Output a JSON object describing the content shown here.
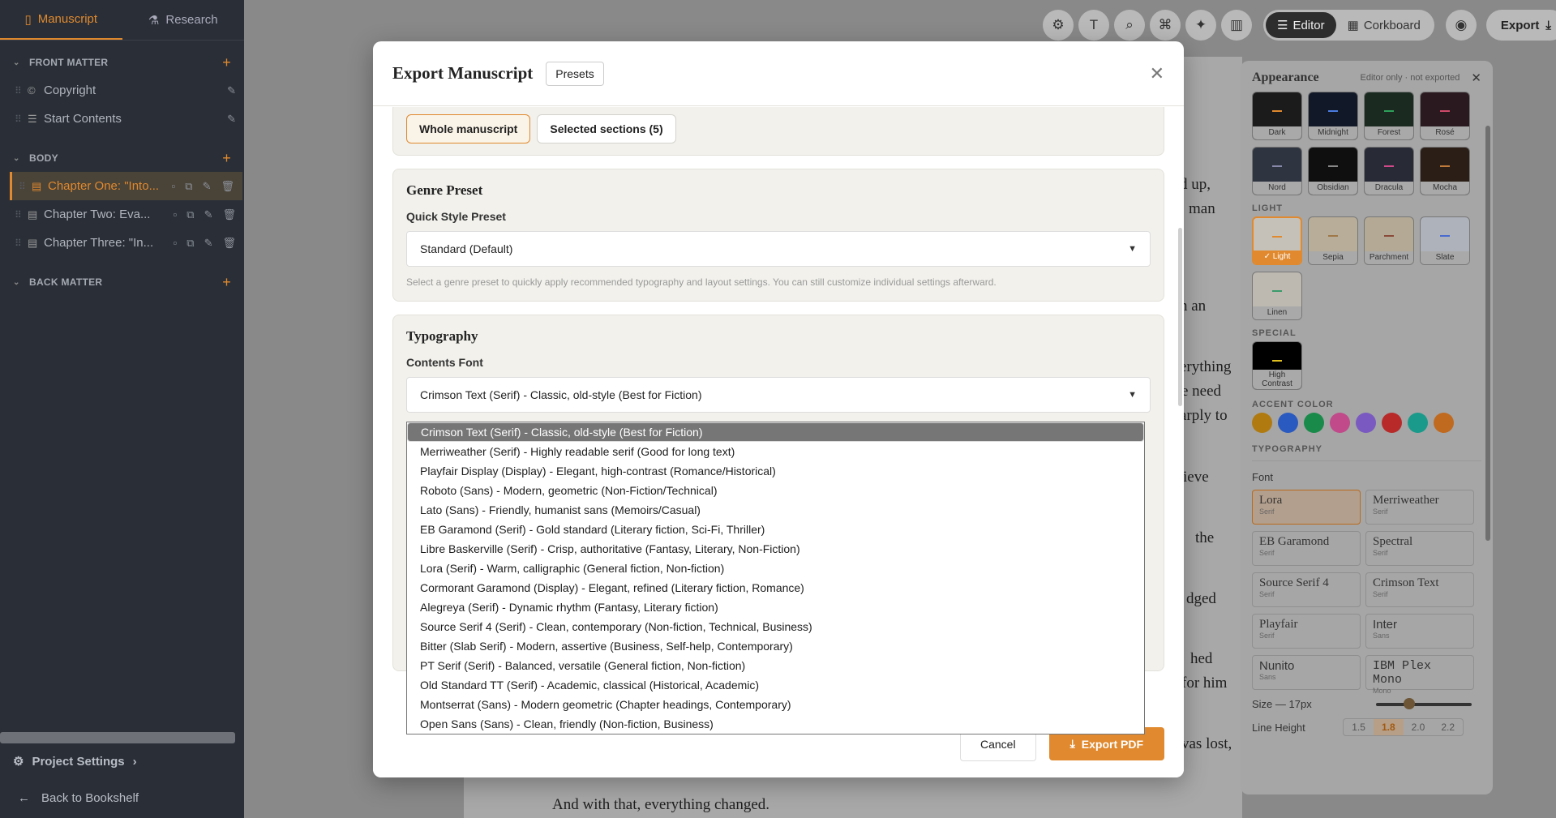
{
  "sidebar": {
    "tabs": [
      {
        "label": "Manuscript",
        "icon": "book-icon"
      },
      {
        "label": "Research",
        "icon": "flask-icon"
      }
    ],
    "sections": [
      {
        "label": "FRONT MATTER",
        "items": [
          {
            "label": "Copyright",
            "icon": "copyright-icon"
          },
          {
            "label": "Start Contents",
            "icon": "list-icon"
          }
        ]
      },
      {
        "label": "BODY",
        "items": [
          {
            "label": "Chapter One: \"Into...",
            "icon": "document-icon"
          },
          {
            "label": "Chapter Two: Eva...",
            "icon": "document-icon"
          },
          {
            "label": "Chapter Three: \"In...",
            "icon": "document-icon"
          }
        ]
      },
      {
        "label": "BACK MATTER",
        "items": []
      }
    ],
    "project_settings": "Project Settings",
    "back": "Back to Bookshelf"
  },
  "topbar": {
    "editor": "Editor",
    "corkboard": "Corkboard",
    "export": "Export"
  },
  "document": {
    "fragments": [
      "d up,",
      "man",
      "n an",
      "erything",
      "e need",
      "arply to",
      "ieve",
      "the",
      "dged",
      "hed",
      "for him",
      "vas lost,"
    ],
    "last_line": "And with that, everything changed."
  },
  "appearance": {
    "title": "Appearance",
    "subtitle": "Editor only · not exported",
    "dark_themes": [
      {
        "name": "Dark",
        "bg": "#1b1b1b",
        "accent": "#e0892e"
      },
      {
        "name": "Midnight",
        "bg": "#111827",
        "accent": "#4a7be0"
      },
      {
        "name": "Forest",
        "bg": "#1a2a20",
        "accent": "#2ea05a"
      },
      {
        "name": "Rosé",
        "bg": "#2a1a20",
        "accent": "#d04a6a"
      },
      {
        "name": "Nord",
        "bg": "#2e3440",
        "accent": "#88a"
      },
      {
        "name": "Obsidian",
        "bg": "#0f0f0f",
        "accent": "#888"
      },
      {
        "name": "Dracula",
        "bg": "#282a36",
        "accent": "#d04a8a"
      },
      {
        "name": "Mocha",
        "bg": "#2a1e17",
        "accent": "#c07a3a"
      }
    ],
    "light_label": "LIGHT",
    "light_themes": [
      {
        "name": "✓ Light",
        "bg": "#c6c1b8",
        "accent": "#e0892e"
      },
      {
        "name": "Sepia",
        "bg": "#b8ad98",
        "accent": "#a0784a"
      },
      {
        "name": "Parchment",
        "bg": "#b3a994",
        "accent": "#8a4a3a"
      },
      {
        "name": "Slate",
        "bg": "#aeb3bb",
        "accent": "#4a6ad0"
      },
      {
        "name": "Linen",
        "bg": "#bdb9b1",
        "accent": "#3a9a6a"
      }
    ],
    "special_label": "SPECIAL",
    "special_themes": [
      {
        "name": "High Contrast",
        "bg": "#000000",
        "accent": "#e0c020"
      }
    ],
    "accent_label": "ACCENT COLOR",
    "accent_colors": [
      "#b07a10",
      "#2a5ac0",
      "#1a8a4a",
      "#c04a8a",
      "#7a5ac0",
      "#b82a2a",
      "#1a9a8a",
      "#c06a20"
    ],
    "typography_label": "TYPOGRAPHY",
    "font_label": "Font",
    "fonts": [
      {
        "name": "Lora",
        "kind": "Serif"
      },
      {
        "name": "Merriweather",
        "kind": "Serif"
      },
      {
        "name": "EB Garamond",
        "kind": "Serif"
      },
      {
        "name": "Spectral",
        "kind": "Serif"
      },
      {
        "name": "Source Serif 4",
        "kind": "Serif"
      },
      {
        "name": "Crimson Text",
        "kind": "Serif"
      },
      {
        "name": "Playfair",
        "kind": "Serif"
      },
      {
        "name": "Inter",
        "kind": "Sans"
      },
      {
        "name": "Nunito",
        "kind": "Sans"
      },
      {
        "name": "IBM Plex Mono",
        "kind": "Mono"
      }
    ],
    "size_label": "Size — 17px",
    "size_fraction": 0.35,
    "line_height_label": "Line Height",
    "line_heights": [
      "1.5",
      "1.8",
      "2.0",
      "2.2"
    ],
    "line_height_selected": "1.8"
  },
  "modal": {
    "title": "Export Manuscript",
    "presets": "Presets",
    "scope": {
      "whole": "Whole manuscript",
      "selected": "Selected sections (5)"
    },
    "genre": {
      "heading": "Genre Preset",
      "field": "Quick Style Preset",
      "value": "Standard (Default)",
      "help": "Select a genre preset to quickly apply recommended typography and layout settings. You can still customize individual settings afterward."
    },
    "typography": {
      "heading": "Typography",
      "field": "Contents Font",
      "value": "Crimson Text (Serif) - Classic, old-style (Best for Fiction)"
    },
    "cancel": "Cancel",
    "export_pdf": "Export PDF"
  },
  "font_options": [
    "Crimson Text (Serif) - Classic, old-style (Best for Fiction)",
    "Merriweather (Serif) - Highly readable serif (Good for long text)",
    "Playfair Display (Display) - Elegant, high-contrast (Romance/Historical)",
    "Roboto (Sans) - Modern, geometric (Non-Fiction/Technical)",
    "Lato (Sans) - Friendly, humanist sans (Memoirs/Casual)",
    "EB Garamond (Serif) - Gold standard (Literary fiction, Sci-Fi, Thriller)",
    "Libre Baskerville (Serif) - Crisp, authoritative (Fantasy, Literary, Non-Fiction)",
    "Lora (Serif) - Warm, calligraphic (General fiction, Non-fiction)",
    "Cormorant Garamond (Display) - Elegant, refined (Literary fiction, Romance)",
    "Alegreya (Serif) - Dynamic rhythm (Fantasy, Literary fiction)",
    "Source Serif 4 (Serif) - Clean, contemporary (Non-fiction, Technical, Business)",
    "Bitter (Slab Serif) - Modern, assertive (Business, Self-help, Contemporary)",
    "PT Serif (Serif) - Balanced, versatile (General fiction, Non-fiction)",
    "Old Standard TT (Serif) - Academic, classical (Historical, Academic)",
    "Montserrat (Sans) - Modern geometric (Chapter headings, Contemporary)",
    "Open Sans (Sans) - Clean, friendly (Non-fiction, Business)"
  ]
}
